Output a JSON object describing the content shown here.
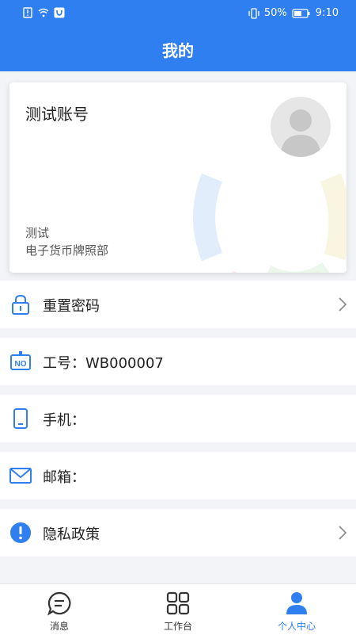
{
  "status_bar": {
    "battery": "50%",
    "time": "9:10"
  },
  "header": {
    "title": "我的"
  },
  "profile": {
    "account_name": "测试账号",
    "dept_line1": "测试",
    "dept_line2": "电子货币牌照部"
  },
  "menu": {
    "reset_password": "重置密码",
    "employee_id": "工号：WB000007",
    "phone": "手机：",
    "email": "邮箱：",
    "privacy": "隐私政策"
  },
  "tabs": [
    {
      "label": "消息"
    },
    {
      "label": "工作台"
    },
    {
      "label": "个人中心"
    }
  ],
  "colors": {
    "primary": "#2f7ff0",
    "background": "#f2f4f8"
  }
}
